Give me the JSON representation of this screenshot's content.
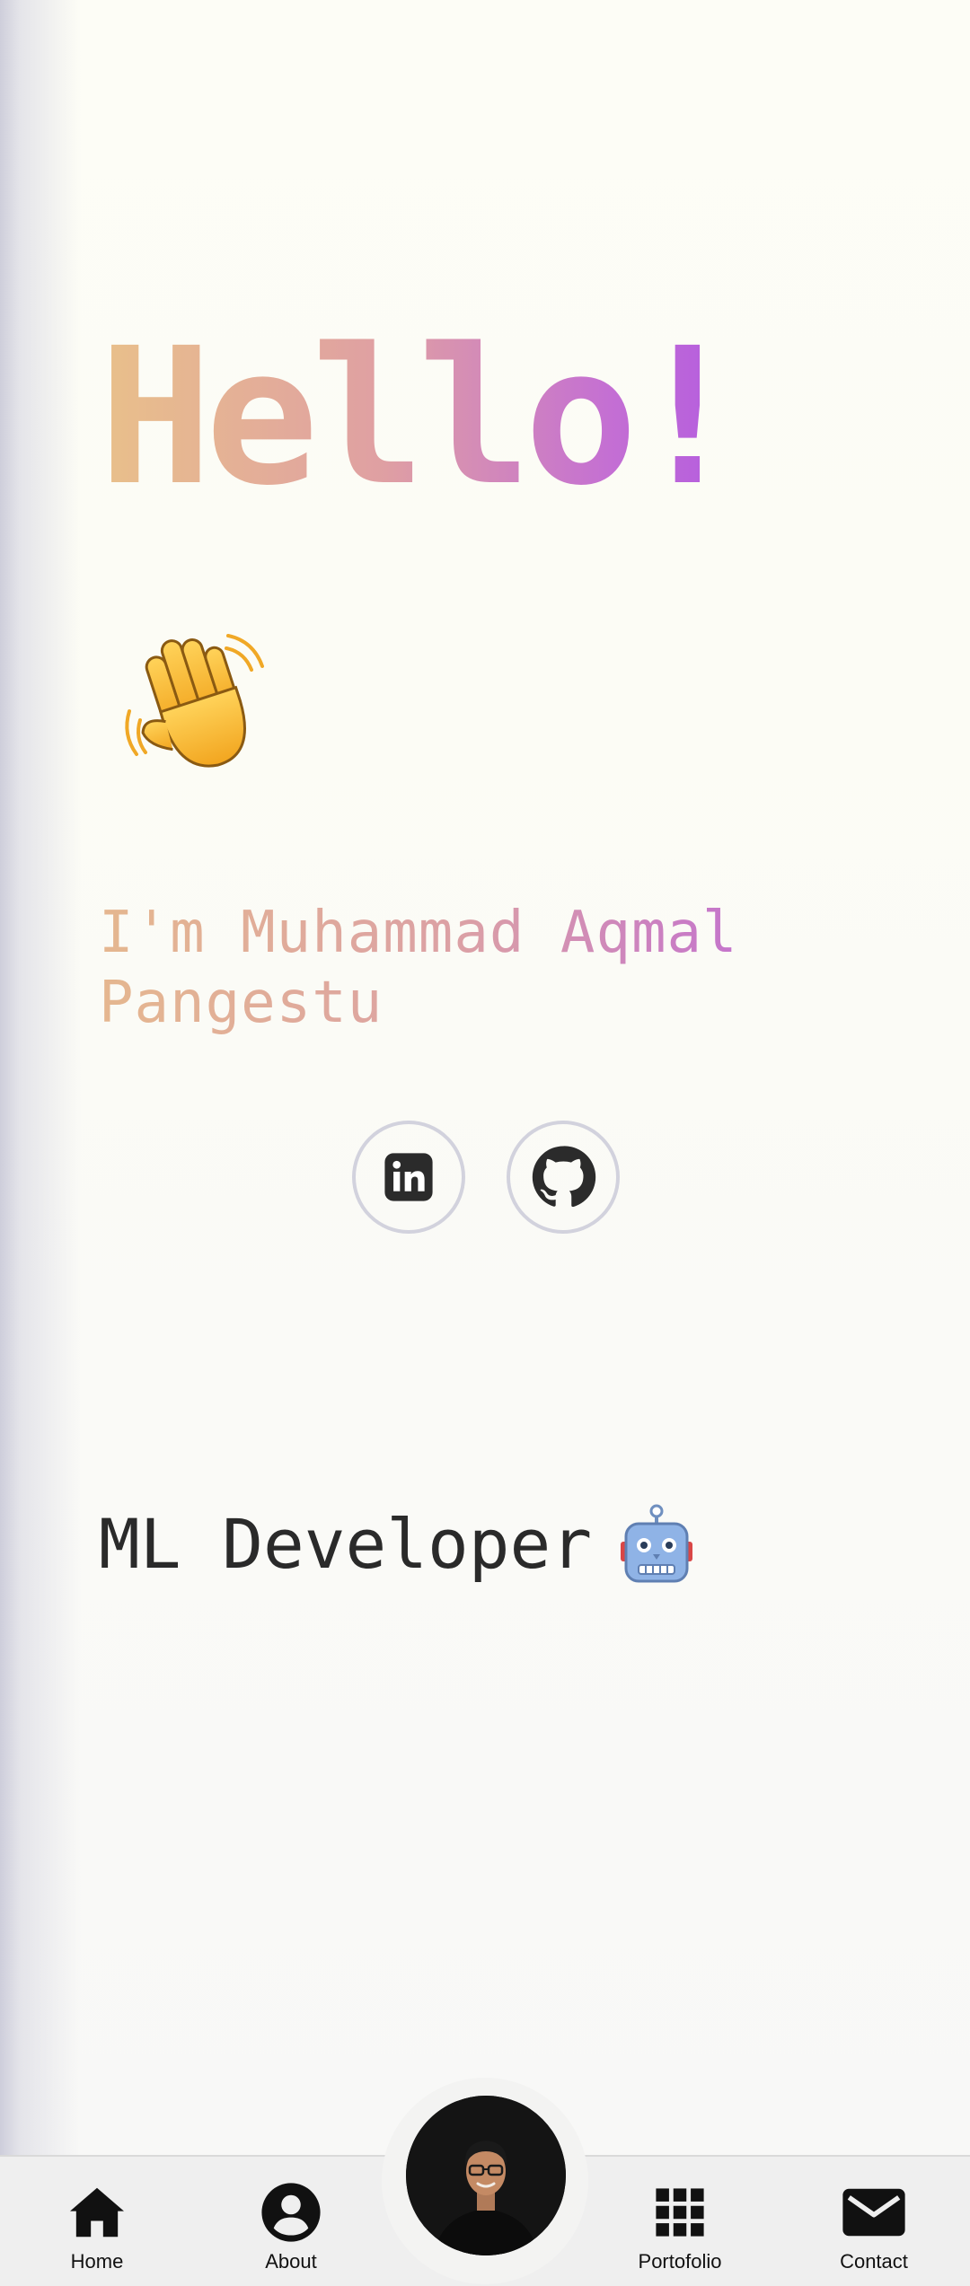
{
  "hero": {
    "greeting": "Hello!",
    "wave_icon": "waving-hand-icon",
    "intro": "I'm Muhammad Aqmal Pangestu"
  },
  "socials": [
    {
      "name": "LinkedIn",
      "icon": "linkedin-icon"
    },
    {
      "name": "GitHub",
      "icon": "github-icon"
    }
  ],
  "role": {
    "title": "ML Developer",
    "icon": "robot-icon"
  },
  "nav": {
    "items": [
      {
        "label": "Home",
        "icon": "home-icon"
      },
      {
        "label": "About",
        "icon": "user-circle-icon"
      },
      {
        "label": "Portofolio",
        "icon": "grid-icon"
      },
      {
        "label": "Contact",
        "icon": "mail-icon"
      }
    ],
    "avatar_icon": "profile-avatar"
  },
  "colors": {
    "gradient_start": "#e9c08a",
    "gradient_mid": "#df9fa3",
    "gradient_end": "#b35be0",
    "text_dark": "#2a2a2a",
    "nav_bg": "#efefef"
  }
}
